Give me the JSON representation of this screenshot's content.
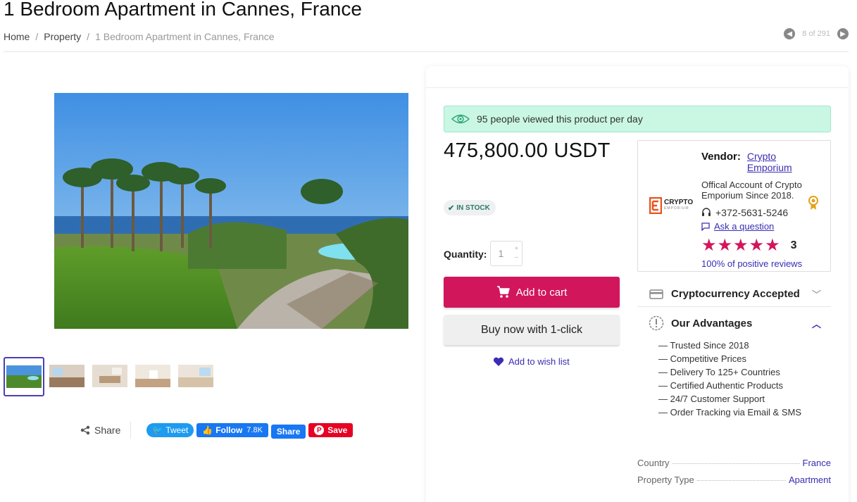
{
  "page": {
    "title": "1 Bedroom Apartment in Cannes, France",
    "breadcrumb": [
      "Home",
      "Property",
      "1 Bedroom Apartment in Cannes, France"
    ],
    "pager": "8 of 291"
  },
  "gallery": {
    "thumbnail_count": 5,
    "active_thumbnail": 1
  },
  "share": {
    "label": "Share",
    "tweet": "Tweet",
    "fb_follow": "Follow",
    "fb_count": "7.8K",
    "fb_share": "Share",
    "pin_save": "Save"
  },
  "product": {
    "viewed_text": "95 people viewed this product per day",
    "price_amount": "475,800.00",
    "price_currency": "USDT",
    "stock": "IN STOCK",
    "quantity_label": "Quantity:",
    "quantity_value": "1",
    "add_to_cart": "Add to cart",
    "buy_now": "Buy now with 1-click",
    "wishlist": "Add to wish list"
  },
  "vendor": {
    "label": "Vendor:",
    "name": "Crypto Emporium",
    "description": "Offical Account of Crypto Emporium Since 2018.",
    "phone": "+372-5631-5246",
    "ask": "Ask a question",
    "rating_stars": 5,
    "rating_count": "3",
    "positive": "100% of positive reviews",
    "logo_text": "CRYPTO",
    "logo_sub": "EMPORIUM"
  },
  "accordion": {
    "crypto_title": "Cryptocurrency Accepted",
    "advantages_title": "Our Advantages",
    "advantages": [
      "— Trusted Since 2018",
      "— Competitive Prices",
      "— Delivery To 125+ Countries",
      "— Certified Authentic Products",
      "— 24/7 Customer Support",
      "— Order Tracking via Email & SMS"
    ]
  },
  "specs": [
    {
      "label": "Country",
      "value": "France"
    },
    {
      "label": "Property Type",
      "value": "Apartment"
    }
  ],
  "colors": {
    "accent": "#d1165c",
    "link": "#3a2db3",
    "viewed_bg": "#c9f7e4"
  }
}
